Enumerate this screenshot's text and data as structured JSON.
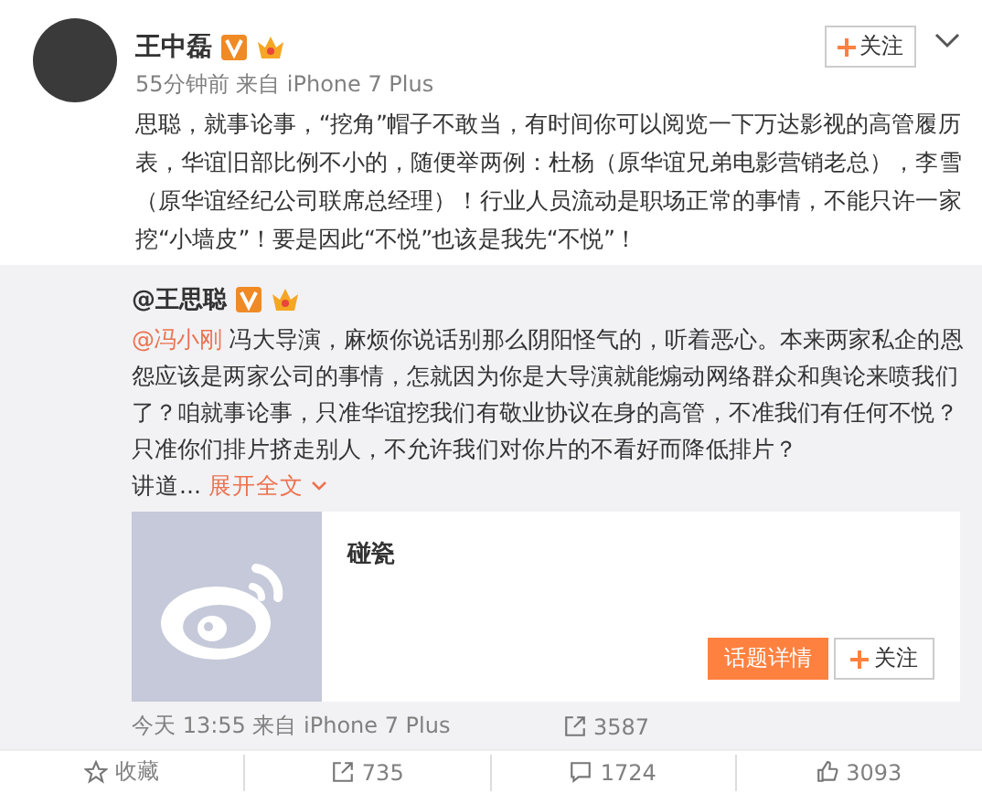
{
  "post": {
    "author": "王中磊",
    "follow_button": "关注",
    "meta": "55分钟前 来自 iPhone 7 Plus",
    "text": "思聪，就事论事，“挖角”帽子不敢当，有时间你可以阅览一下万达影视的高管履历表，华谊旧部比例不小的，随便举两例：杜杨（原华谊兄弟电影营销老总），李雪（原华谊经纪公司联席总经理）！行业人员流动是职场正常的事情，不能只许一家挖“小墙皮”！要是因此“不悦”也该是我先“不悦”！"
  },
  "repost": {
    "author": "@王思聪",
    "mention": "@冯小刚",
    "text": " 冯大导演，麻烦你说话别那么阴阳怪气的，听着恶心。本来两家私企的恩怨应该是两家公司的事情，怎就因为你是大导演就能煽动网络群众和舆论来喷我们了？咱就事论事，只准华谊挖我们有敬业协议在身的高管，不准我们有任何不悦？只准你们排片挤走别人，不允许我们对你片的不看好而降低排片？",
    "truncated": "讲道...",
    "expand_link": "展开全文",
    "card": {
      "title": "碰瓷",
      "buttons": [
        {
          "label": "话题详情",
          "kind": "primary"
        },
        {
          "label": "关注",
          "kind": "follow"
        }
      ]
    },
    "meta": "今天 13:55 来自 iPhone 7 Plus",
    "forwards": "3587"
  },
  "actions": [
    {
      "kind": "favorite",
      "label": "收藏"
    },
    {
      "kind": "forward",
      "label": "735"
    },
    {
      "kind": "comment",
      "label": "1724"
    },
    {
      "kind": "like",
      "label": "3093"
    }
  ]
}
